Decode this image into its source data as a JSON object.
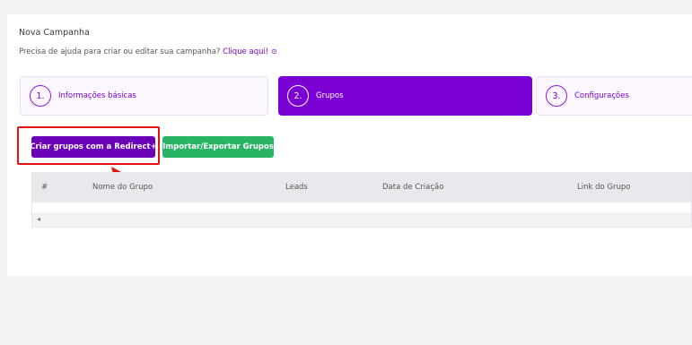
{
  "page": {
    "title": "Nova Campanha",
    "help_text": "Precisa de ajuda para criar ou editar sua campanha?",
    "help_link": "Clique aqui!",
    "help_link_icon": "⊙"
  },
  "steps": [
    {
      "number": "1.",
      "label": "Informações básicas",
      "active": false
    },
    {
      "number": "2.",
      "label": "Grupos",
      "active": true
    },
    {
      "number": "3.",
      "label": "Configurações",
      "active": false
    }
  ],
  "actions": {
    "create_groups_label": "Criar grupos com a Redirect+",
    "import_export_label": "Importar/Exportar Grupos"
  },
  "table": {
    "columns": [
      "#",
      "Nome do Grupo",
      "Leads",
      "Data de Criação",
      "Link do Grupo"
    ],
    "rows": [],
    "scroll_left_icon": "◂"
  },
  "colors": {
    "accent": "#7a00d4",
    "primary_button": "#6a00b8",
    "success_button": "#28b463",
    "highlight": "#e21212"
  }
}
